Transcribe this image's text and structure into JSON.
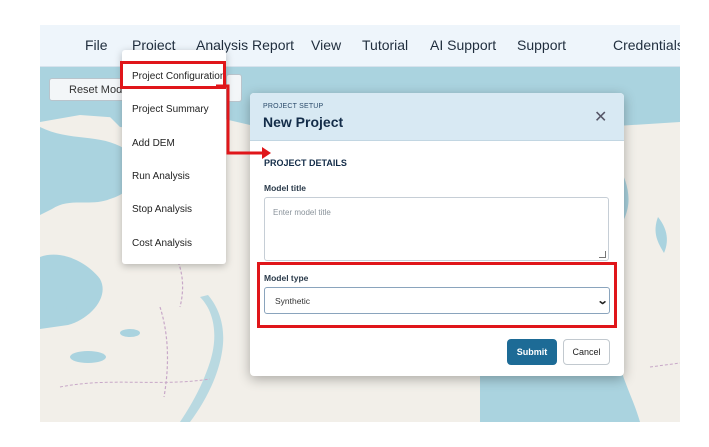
{
  "nav": {
    "items": [
      {
        "label": "File"
      },
      {
        "label": "Project"
      },
      {
        "label": "Analysis Report"
      },
      {
        "label": "View"
      },
      {
        "label": "Tutorial"
      },
      {
        "label": "AI Support"
      },
      {
        "label": "Support"
      },
      {
        "label": "Credentials"
      }
    ]
  },
  "map_toolbar": {
    "reset_label": "Reset Model"
  },
  "project_menu": {
    "items": [
      {
        "label": "Project Configuration"
      },
      {
        "label": "Project Summary"
      },
      {
        "label": "Add DEM"
      },
      {
        "label": "Run Analysis"
      },
      {
        "label": "Stop Analysis"
      },
      {
        "label": "Cost Analysis"
      }
    ]
  },
  "modal": {
    "eyebrow": "PROJECT SETUP",
    "title": "New Project",
    "close_icon": "close-icon",
    "section": "PROJECT DETAILS",
    "model_title_label": "Model title",
    "model_title_placeholder": "Enter model title",
    "model_title_value": "",
    "model_type_label": "Model type",
    "model_type_value": "Synthetic",
    "submit_label": "Submit",
    "cancel_label": "Cancel"
  },
  "colors": {
    "highlight": "#e0161a",
    "submit": "#1d6b96",
    "modal_header": "#d8e9f3",
    "map_water": "#aad3df",
    "map_land": "#f2efe9"
  }
}
